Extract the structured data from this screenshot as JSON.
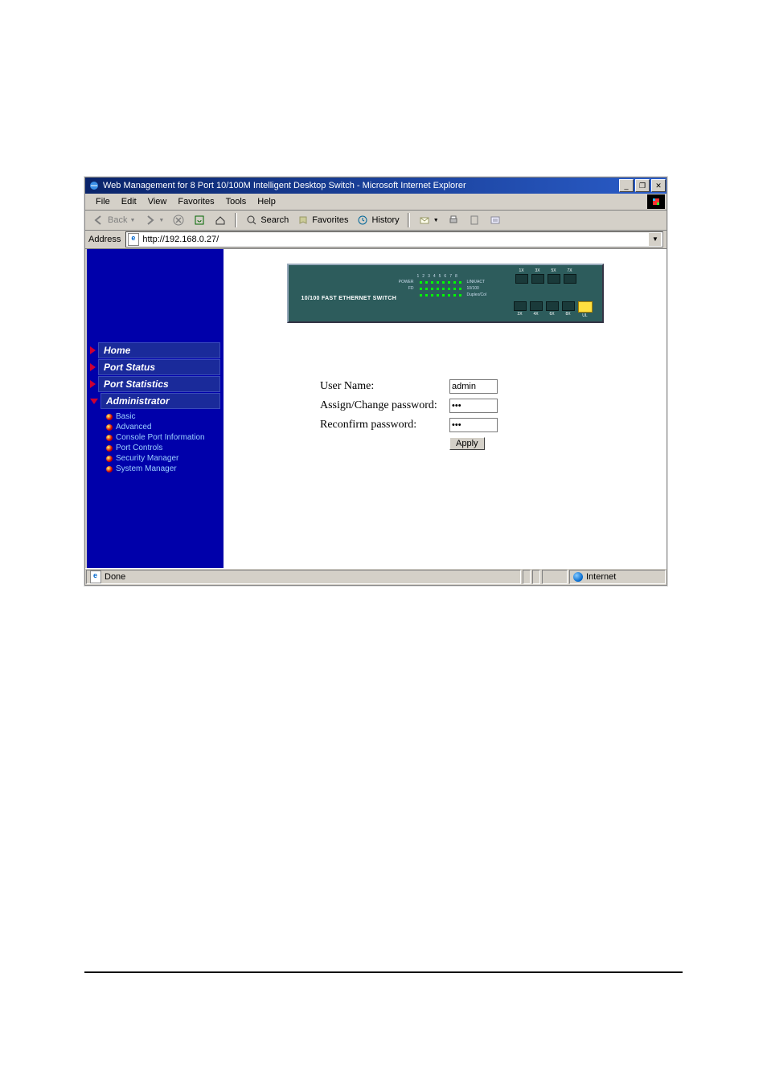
{
  "window": {
    "title": "Web Management for 8 Port 10/100M Intelligent Desktop Switch - Microsoft Internet Explorer"
  },
  "menu": {
    "items": [
      "File",
      "Edit",
      "View",
      "Favorites",
      "Tools",
      "Help"
    ]
  },
  "toolbar": {
    "back": "Back",
    "search": "Search",
    "favorites": "Favorites",
    "history": "History"
  },
  "address": {
    "label": "Address",
    "url": "http://192.168.0.27/"
  },
  "sidebar": {
    "items": [
      {
        "label": "Home"
      },
      {
        "label": "Port Status"
      },
      {
        "label": "Port Statistics"
      },
      {
        "label": "Administrator"
      }
    ],
    "subitems": [
      "Basic",
      "Advanced",
      "Console Port Information",
      "Port Controls",
      "Security Manager",
      "System Manager"
    ]
  },
  "switch": {
    "model": "10/100 FAST ETHERNET SWITCH",
    "led_row_labels_left": [
      "POWER",
      "FD",
      ""
    ],
    "led_row_labels_right": [
      "LINK/ACT",
      "10/100",
      "Duplex/Col"
    ],
    "led_numbers": [
      "1",
      "2",
      "3",
      "4",
      "5",
      "6",
      "7",
      "8"
    ],
    "ports_top": [
      "1X",
      "3X",
      "5X",
      "7X"
    ],
    "ports_bottom": [
      "2X",
      "4X",
      "6X",
      "8X",
      "UL"
    ]
  },
  "form": {
    "username_label": "User Name:",
    "username_value": "admin",
    "password_label": "Assign/Change password:",
    "password_value": "***",
    "confirm_label": "Reconfirm password:",
    "confirm_value": "***",
    "apply": "Apply"
  },
  "statusbar": {
    "left": "Done",
    "right": "Internet"
  }
}
